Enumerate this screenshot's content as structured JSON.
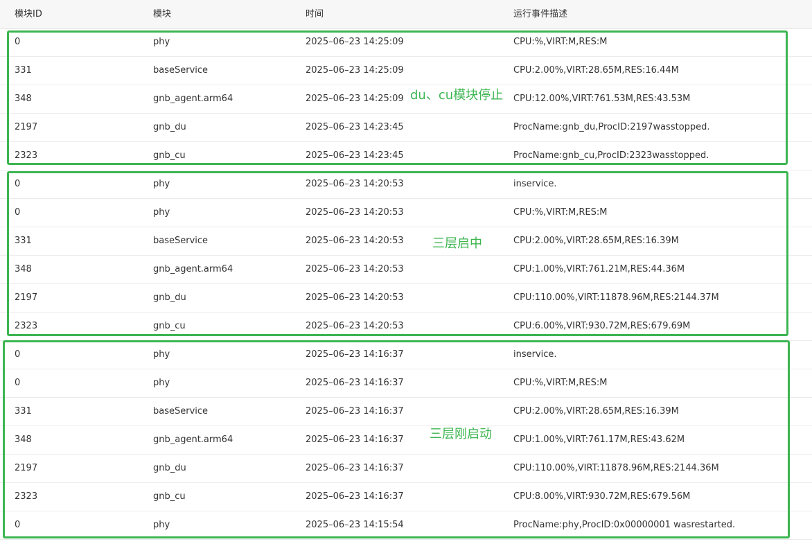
{
  "columns": [
    "模块ID",
    "模块",
    "时间",
    "运行事件描述"
  ],
  "rows": [
    [
      "0",
      "phy",
      "2025–06–23 14:25:09",
      "CPU:%,VIRT:M,RES:M"
    ],
    [
      "331",
      "baseService",
      "2025–06–23 14:25:09",
      "CPU:2.00%,VIRT:28.65M,RES:16.44M"
    ],
    [
      "348",
      "gnb_agent.arm64",
      "2025–06–23 14:25:09",
      "CPU:12.00%,VIRT:761.53M,RES:43.53M"
    ],
    [
      "2197",
      "gnb_du",
      "2025–06–23 14:23:45",
      "ProcName:gnb_du,ProcID:2197wasstopped."
    ],
    [
      "2323",
      "gnb_cu",
      "2025–06–23 14:23:45",
      "ProcName:gnb_cu,ProcID:2323wasstopped."
    ],
    [
      "0",
      "phy",
      "2025–06–23 14:20:53",
      "inservice."
    ],
    [
      "0",
      "phy",
      "2025–06–23 14:20:53",
      "CPU:%,VIRT:M,RES:M"
    ],
    [
      "331",
      "baseService",
      "2025–06–23 14:20:53",
      "CPU:2.00%,VIRT:28.65M,RES:16.39M"
    ],
    [
      "348",
      "gnb_agent.arm64",
      "2025–06–23 14:20:53",
      "CPU:1.00%,VIRT:761.21M,RES:44.36M"
    ],
    [
      "2197",
      "gnb_du",
      "2025–06–23 14:20:53",
      "CPU:110.00%,VIRT:11878.96M,RES:2144.37M"
    ],
    [
      "2323",
      "gnb_cu",
      "2025–06–23 14:20:53",
      "CPU:6.00%,VIRT:930.72M,RES:679.69M"
    ],
    [
      "0",
      "phy",
      "2025–06–23 14:16:37",
      "inservice."
    ],
    [
      "0",
      "phy",
      "2025–06–23 14:16:37",
      "CPU:%,VIRT:M,RES:M"
    ],
    [
      "331",
      "baseService",
      "2025–06–23 14:16:37",
      "CPU:2.00%,VIRT:28.65M,RES:16.39M"
    ],
    [
      "348",
      "gnb_agent.arm64",
      "2025–06–23 14:16:37",
      "CPU:1.00%,VIRT:761.17M,RES:43.62M"
    ],
    [
      "2197",
      "gnb_du",
      "2025–06–23 14:16:37",
      "CPU:110.00%,VIRT:11878.96M,RES:2144.36M"
    ],
    [
      "2323",
      "gnb_cu",
      "2025–06–23 14:16:37",
      "CPU:8.00%,VIRT:930.72M,RES:679.56M"
    ],
    [
      "0",
      "phy",
      "2025–06–23 14:15:54",
      "ProcName:phy,ProcID:0x00000001 wasrestarted."
    ]
  ],
  "annotations": {
    "group1_note": "du、cu模块停止",
    "group2_note": "三层启中",
    "group3_note": "三层刚启动"
  },
  "colors": {
    "annotation": "#3cb551",
    "header_bg": "#f7f7f7",
    "row_border": "#ececec"
  }
}
